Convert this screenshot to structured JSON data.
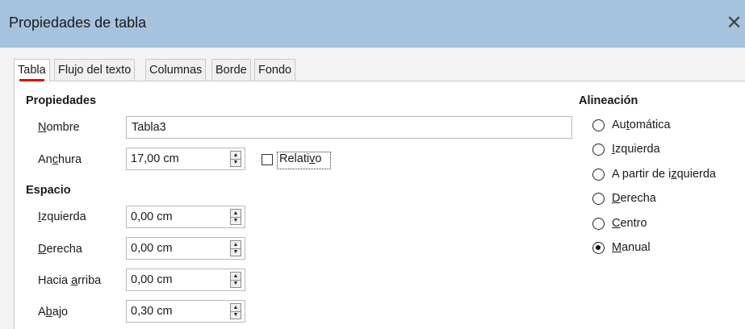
{
  "window": {
    "title": "Propiedades de tabla",
    "close_glyph": "✕"
  },
  "tabs": [
    {
      "label": "Tabla",
      "active": true
    },
    {
      "label": "Flujo del texto",
      "active": false
    },
    {
      "label": "Columnas",
      "active": false
    },
    {
      "label": "Borde",
      "active": false
    },
    {
      "label": "Fondo",
      "active": false
    }
  ],
  "properties": {
    "heading": "Propiedades",
    "name": {
      "label": "Nombre",
      "mnemonic": "N",
      "value": "Tabla3"
    },
    "width": {
      "label": "Anchura",
      "value": "17,00 cm"
    },
    "relative": {
      "label": "Relativo",
      "checked": false
    }
  },
  "spacing": {
    "heading": "Espacio",
    "fields": [
      {
        "label": "Izquierda",
        "value": "0,00 cm"
      },
      {
        "label": "Derecha",
        "value": "0,00 cm"
      },
      {
        "label": "Hacia arriba",
        "value": "0,00 cm"
      },
      {
        "label": "Abajo",
        "value": "0,30 cm"
      }
    ]
  },
  "alignment": {
    "heading": "Alineación",
    "options": [
      {
        "label": "Automática",
        "checked": false
      },
      {
        "label": "Izquierda",
        "checked": false
      },
      {
        "label": "A partir de izquierda",
        "checked": false
      },
      {
        "label": "Derecha",
        "checked": false
      },
      {
        "label": "Centro",
        "checked": false
      },
      {
        "label": "Manual",
        "checked": true
      }
    ]
  },
  "colors": {
    "titlebar": "#a7c2dd",
    "active_tab_indicator": "#e8000d"
  }
}
